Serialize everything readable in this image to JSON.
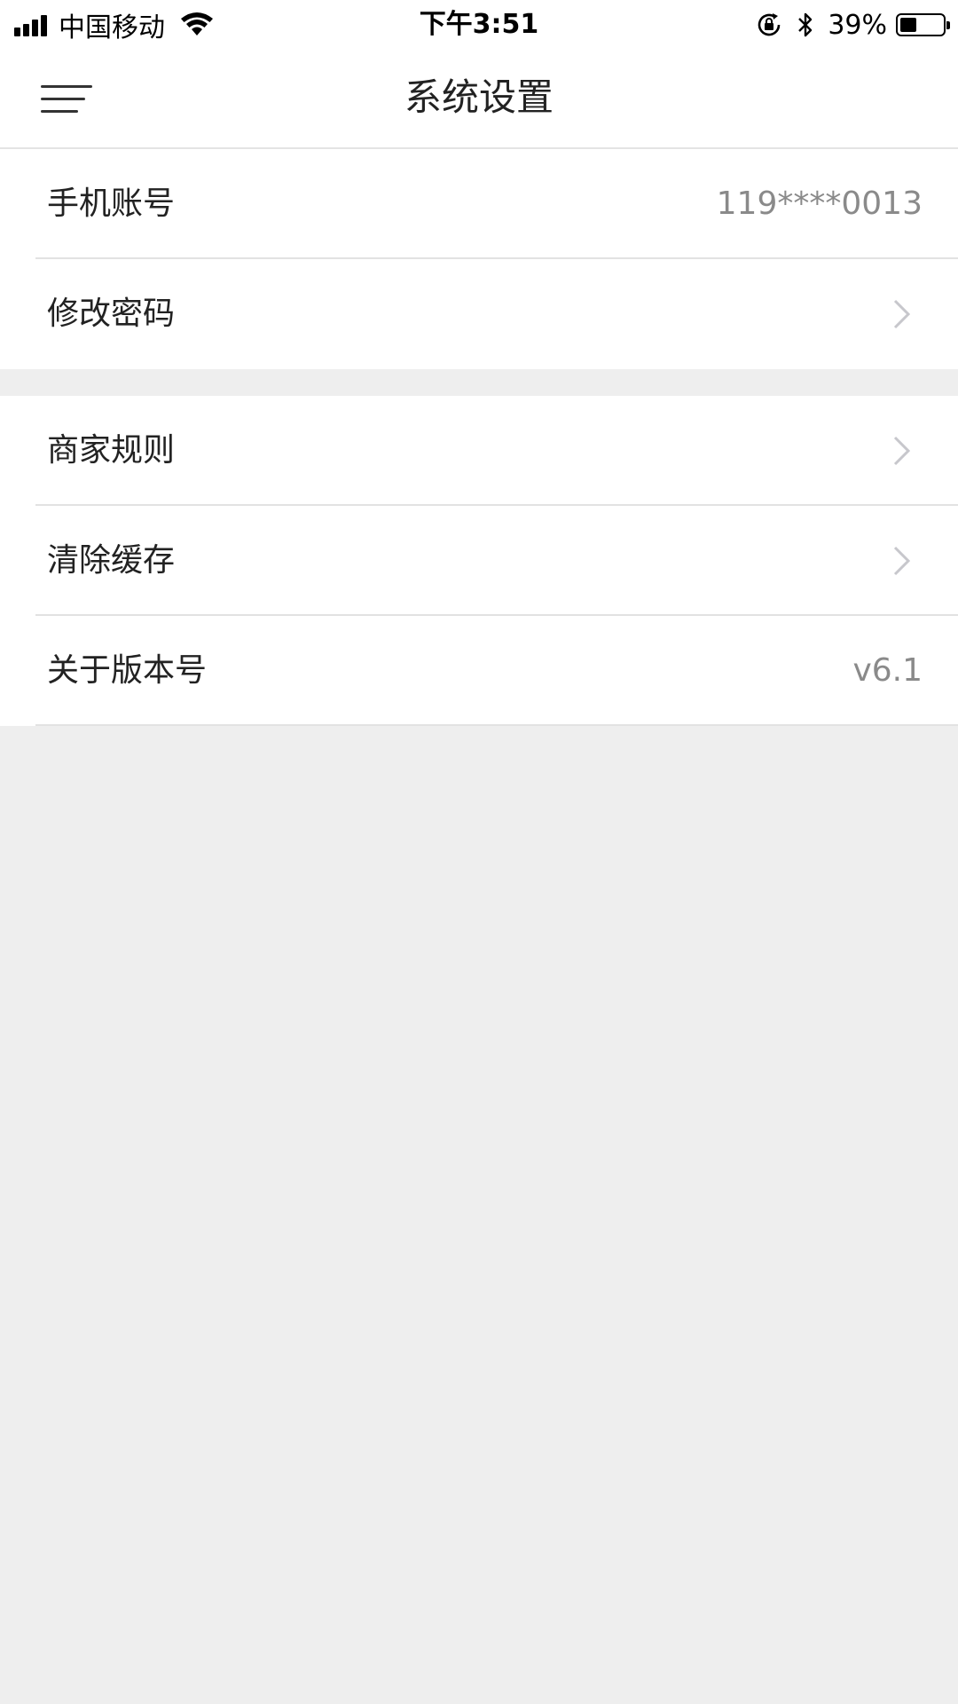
{
  "status_bar": {
    "carrier": "中国移动",
    "time": "下午3:51",
    "battery_percent": "39%",
    "battery_level": 0.39,
    "icons": [
      "signal-icon",
      "wifi-icon",
      "rotation-lock-icon",
      "bluetooth-icon",
      "battery-icon"
    ]
  },
  "nav": {
    "title": "系统设置",
    "menu_icon": "menu-icon"
  },
  "groups": [
    {
      "items": [
        {
          "label": "手机账号",
          "value": "119****0013",
          "chevron": false
        },
        {
          "label": "修改密码",
          "value": "",
          "chevron": true
        }
      ]
    },
    {
      "items": [
        {
          "label": "商家规则",
          "value": "",
          "chevron": true
        },
        {
          "label": "清除缓存",
          "value": "",
          "chevron": true
        },
        {
          "label": "关于版本号",
          "value": "v6.1",
          "chevron": false
        }
      ]
    }
  ],
  "colors": {
    "background": "#eeeeee",
    "surface": "#ffffff",
    "text_primary": "#222222",
    "text_secondary": "#8a8a8a",
    "chevron": "#c7c7cc"
  }
}
